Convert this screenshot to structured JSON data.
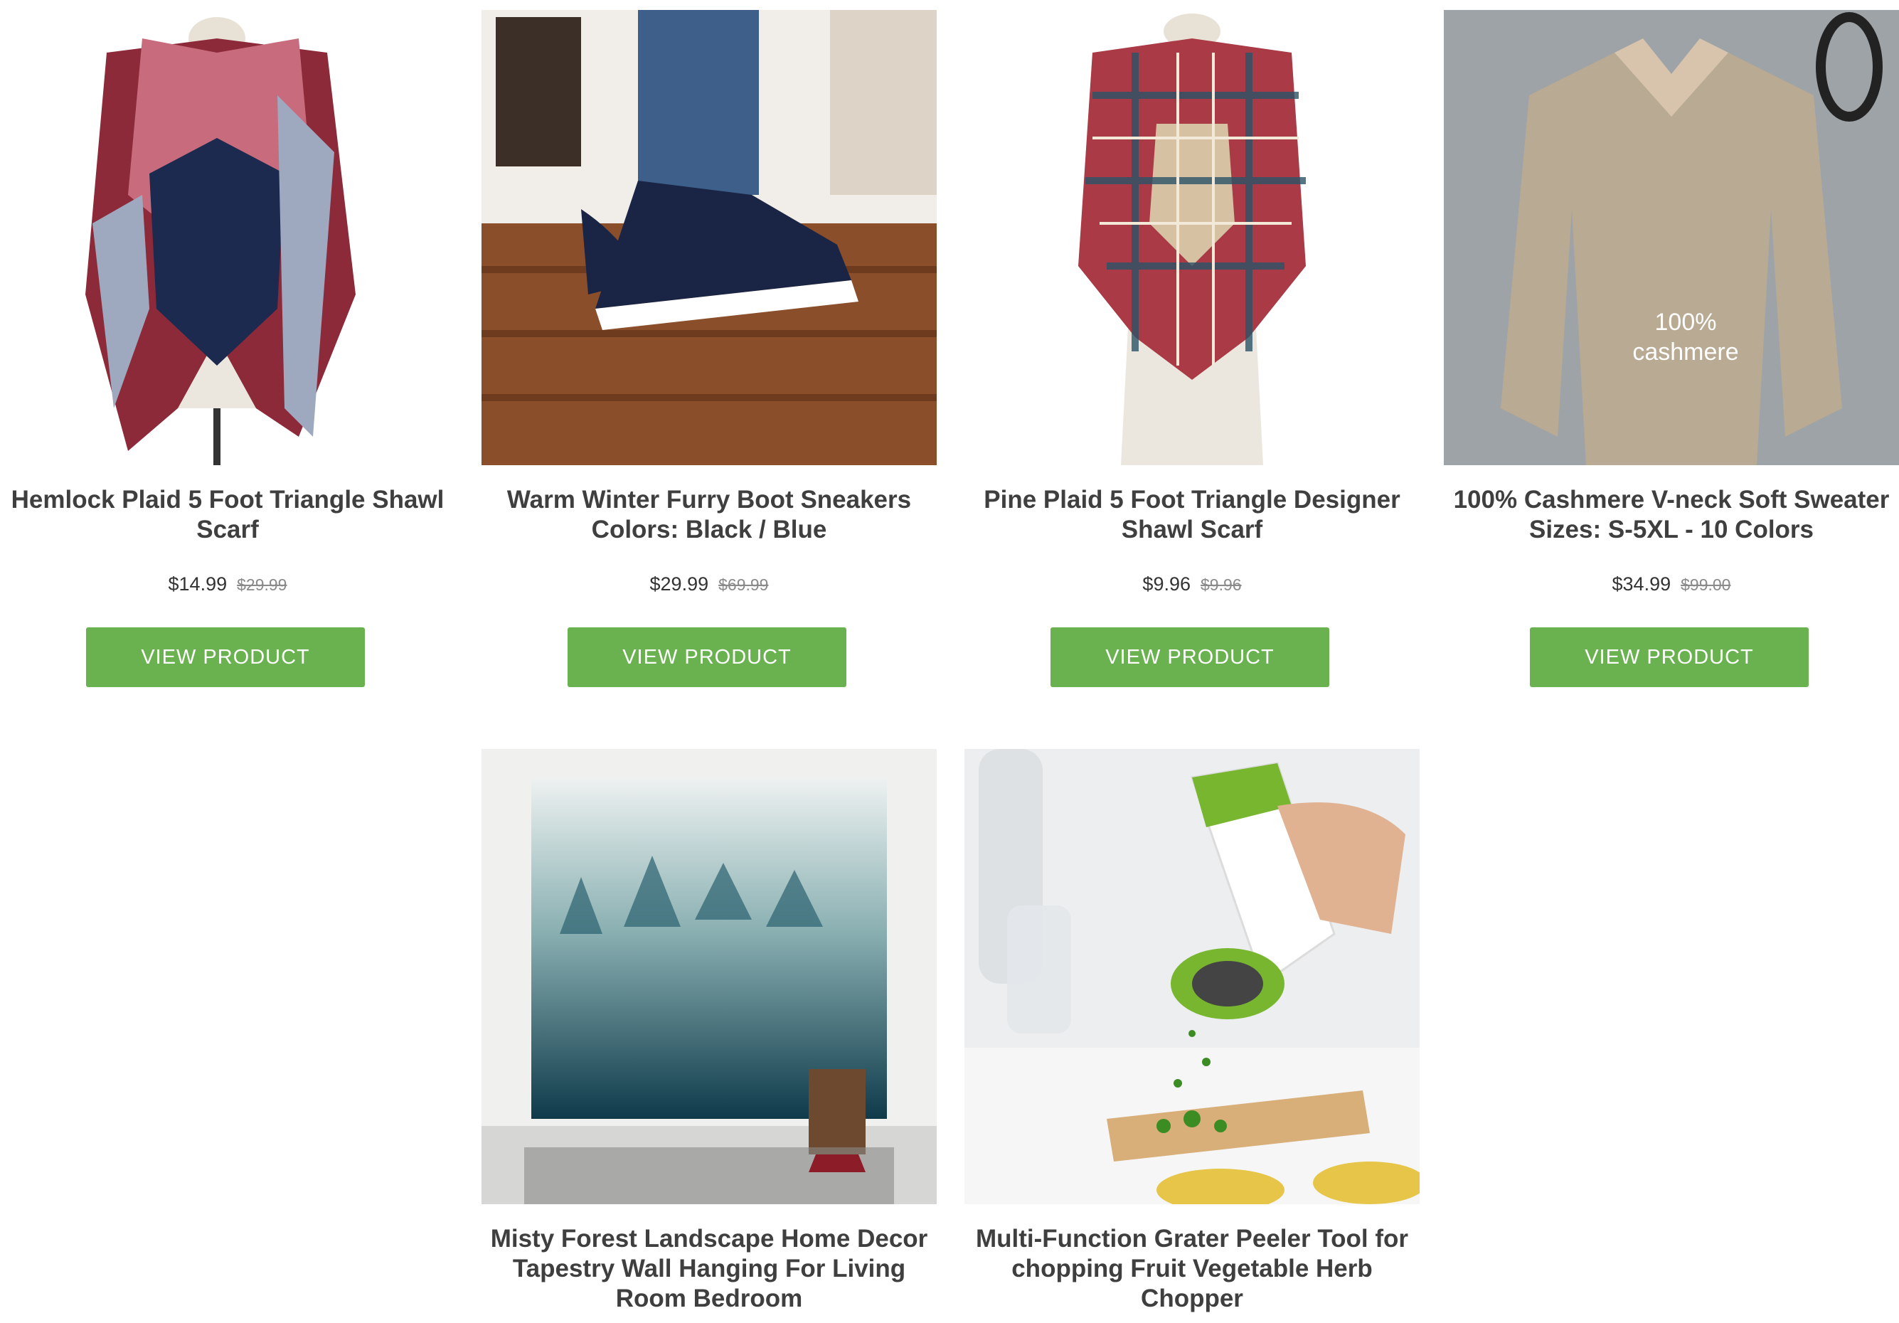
{
  "products": [
    {
      "title": "Hemlock Plaid 5 Foot Triangle Shawl Scarf",
      "price": "$14.99",
      "old_price": "$29.99",
      "button": "VIEW PRODUCT"
    },
    {
      "title": "Warm Winter Furry Boot Sneakers Colors: Black / Blue",
      "price": "$29.99",
      "old_price": "$69.99",
      "button": "VIEW PRODUCT"
    },
    {
      "title": "Pine Plaid 5 Foot Triangle Designer Shawl Scarf",
      "price": "$9.96",
      "old_price": "$9.96",
      "button": "VIEW PRODUCT"
    },
    {
      "title": "100% Cashmere V-neck Soft Sweater Sizes: S-5XL - 10 Colors",
      "price": "$34.99",
      "old_price": "$99.00",
      "button": "VIEW PRODUCT",
      "image_text": [
        "100%",
        "cashmere"
      ]
    },
    {
      "title": "Misty Forest Landscape Home Decor Tapestry Wall Hanging For Living Room Bedroom"
    },
    {
      "title": "Multi-Function Grater Peeler Tool for chopping Fruit Vegetable Herb Chopper"
    }
  ],
  "colors": {
    "button": "#6ab150",
    "title": "#3f3f3f"
  }
}
